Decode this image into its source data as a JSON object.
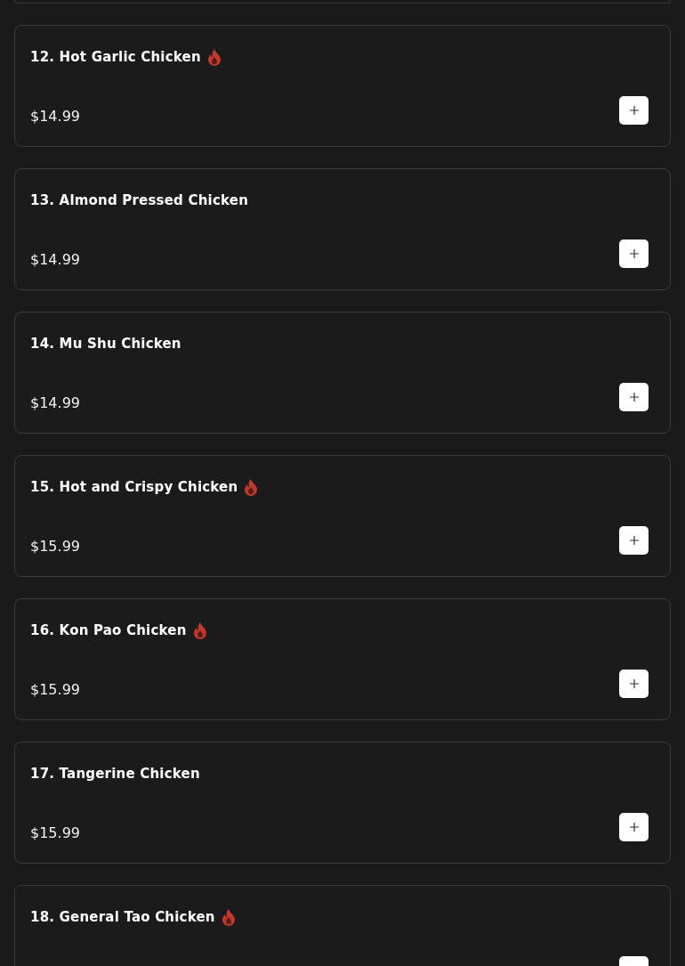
{
  "items": [
    {
      "name": "12. Hot Garlic Chicken",
      "spicy": true,
      "price": "$14.99"
    },
    {
      "name": "13. Almond Pressed Chicken",
      "spicy": false,
      "price": "$14.99"
    },
    {
      "name": "14. Mu Shu Chicken",
      "spicy": false,
      "price": "$14.99"
    },
    {
      "name": "15. Hot and Crispy Chicken",
      "spicy": true,
      "price": "$15.99"
    },
    {
      "name": "16. Kon Pao Chicken",
      "spicy": true,
      "price": "$15.99"
    },
    {
      "name": "17. Tangerine Chicken",
      "spicy": false,
      "price": "$15.99"
    },
    {
      "name": "18. General Tao Chicken",
      "spicy": true
    }
  ]
}
